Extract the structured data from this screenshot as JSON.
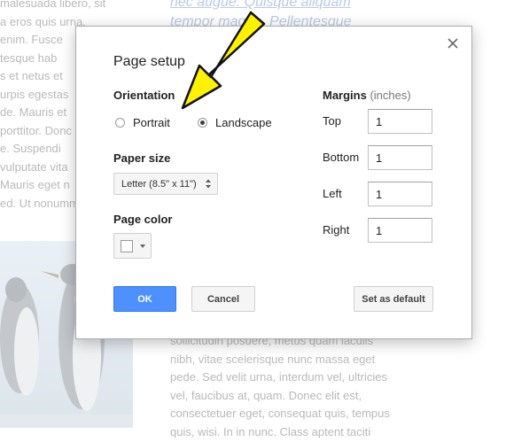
{
  "background": {
    "left_lines": [
      "malesuada libero, sit",
      "a eros quis urna.",
      "enim. Fusce",
      "tesque hab",
      "s et netus et",
      "urpis egestas",
      "de. Mauris et",
      "porttitor. Donc",
      "e. Suspendi",
      "vulputate vita",
      "Mauris eget n",
      "ed. Ut nonumm"
    ],
    "top_right_lines": [
      "nec augue. Quisque aliquam",
      "tempor magna. Pellentesque"
    ],
    "bottom_lines": [
      "sollicitudin posuere, metus quam iaculis",
      "nibh, vitae scelerisque nunc massa eget",
      "pede. Sed velit urna, interdum vel, ultricies",
      "vel, faucibus at, quam. Donec elit est,",
      "consectetuer eget, consequat quis, tempus",
      "quis, wisi. In in nunc. Class aptent taciti"
    ]
  },
  "dialog": {
    "title": "Page setup",
    "close_icon": "close-x-icon",
    "orientation": {
      "label": "Orientation",
      "options": [
        {
          "label": "Portrait",
          "selected": false
        },
        {
          "label": "Landscape",
          "selected": true
        }
      ]
    },
    "paper_size": {
      "label": "Paper size",
      "value": "Letter (8.5\" x 11\")"
    },
    "page_color": {
      "label": "Page color",
      "value": "#ffffff"
    },
    "margins": {
      "label": "Margins",
      "unit": "(inches)",
      "fields": [
        {
          "label": "Top",
          "value": "1"
        },
        {
          "label": "Bottom",
          "value": "1"
        },
        {
          "label": "Left",
          "value": "1"
        },
        {
          "label": "Right",
          "value": "1"
        }
      ]
    },
    "buttons": {
      "ok": "OK",
      "cancel": "Cancel",
      "set_default": "Set as default"
    }
  },
  "colors": {
    "accent_blue": "#4d90fe",
    "arrow_yellow": "#fff200"
  }
}
